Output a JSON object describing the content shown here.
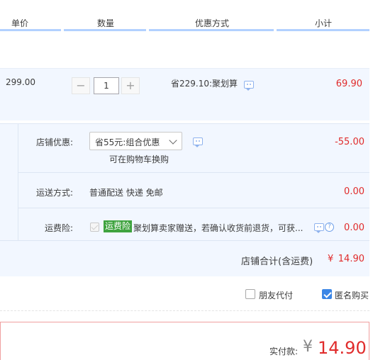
{
  "header": {
    "col_unit_price": "单价",
    "col_quantity": "数量",
    "col_discount": "优惠方式",
    "col_subtotal": "小计"
  },
  "item": {
    "unit_price": "299.00",
    "quantity": "1",
    "minus_label": "−",
    "plus_label": "+",
    "promo_text": "省229.10:聚划算",
    "subtotal": "69.90"
  },
  "shop": {
    "discount_label": "店铺优惠:",
    "discount_select_value": "省55元:组合优惠",
    "discount_hint": "可在购物车换购",
    "discount_amount": "-55.00",
    "shipping_label": "运送方式:",
    "shipping_value": "普通配送 快递 免邮",
    "shipping_amount": "0.00",
    "insurance_label": "运费险:",
    "insurance_tag": "运费险",
    "insurance_desc": "聚划算卖家赠送，若确认收货前退货，可获...",
    "insurance_amount": "0.00",
    "total_label": "店铺合计(含运费)",
    "total_currency": "¥",
    "total_amount": "14.90"
  },
  "options": {
    "friend_pay_label": "朋友代付",
    "friend_pay_checked": false,
    "anonymous_label": "匿名购买",
    "anonymous_checked": true
  },
  "payment": {
    "label": "实付款:",
    "currency": "¥",
    "amount": "14.90"
  },
  "colors": {
    "accent_blue": "#3b86e6",
    "price_red": "#e02b2b",
    "panel_bg": "#f2f7ff",
    "tag_green": "#3fa33f"
  }
}
